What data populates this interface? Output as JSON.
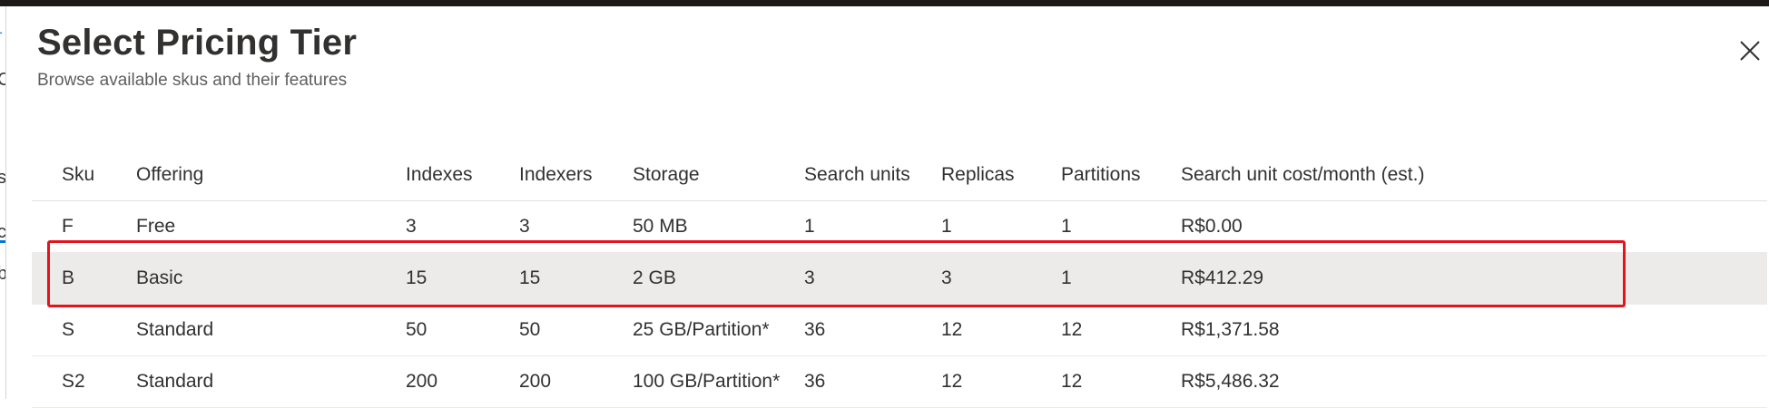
{
  "panel": {
    "title": "Select Pricing Tier",
    "subtitle": "Browse available skus and their features",
    "close_icon": "close-icon"
  },
  "table": {
    "columns": [
      "Sku",
      "Offering",
      "Indexes",
      "Indexers",
      "Storage",
      "Search units",
      "Replicas",
      "Partitions",
      "Search unit cost/month (est.)"
    ],
    "rows": [
      {
        "sku": "F",
        "offering": "Free",
        "indexes": "3",
        "indexers": "3",
        "storage": "50 MB",
        "search_units": "1",
        "replicas": "1",
        "partitions": "1",
        "cost": "R$0.00",
        "selected": false
      },
      {
        "sku": "B",
        "offering": "Basic",
        "indexes": "15",
        "indexers": "15",
        "storage": "2 GB",
        "search_units": "3",
        "replicas": "3",
        "partitions": "1",
        "cost": "R$412.29",
        "selected": true
      },
      {
        "sku": "S",
        "offering": "Standard",
        "indexes": "50",
        "indexers": "50",
        "storage": "25 GB/Partition*",
        "search_units": "36",
        "replicas": "12",
        "partitions": "12",
        "cost": "R$1,371.58",
        "selected": false
      },
      {
        "sku": "S2",
        "offering": "Standard",
        "indexes": "200",
        "indexers": "200",
        "storage": "100 GB/Partition*",
        "search_units": "36",
        "replicas": "12",
        "partitions": "12",
        "cost": "R$5,486.32",
        "selected": false
      }
    ]
  },
  "colors": {
    "highlight_border": "#e3141c",
    "selected_row_bg": "#edebe9",
    "accent": "#0078d4"
  }
}
